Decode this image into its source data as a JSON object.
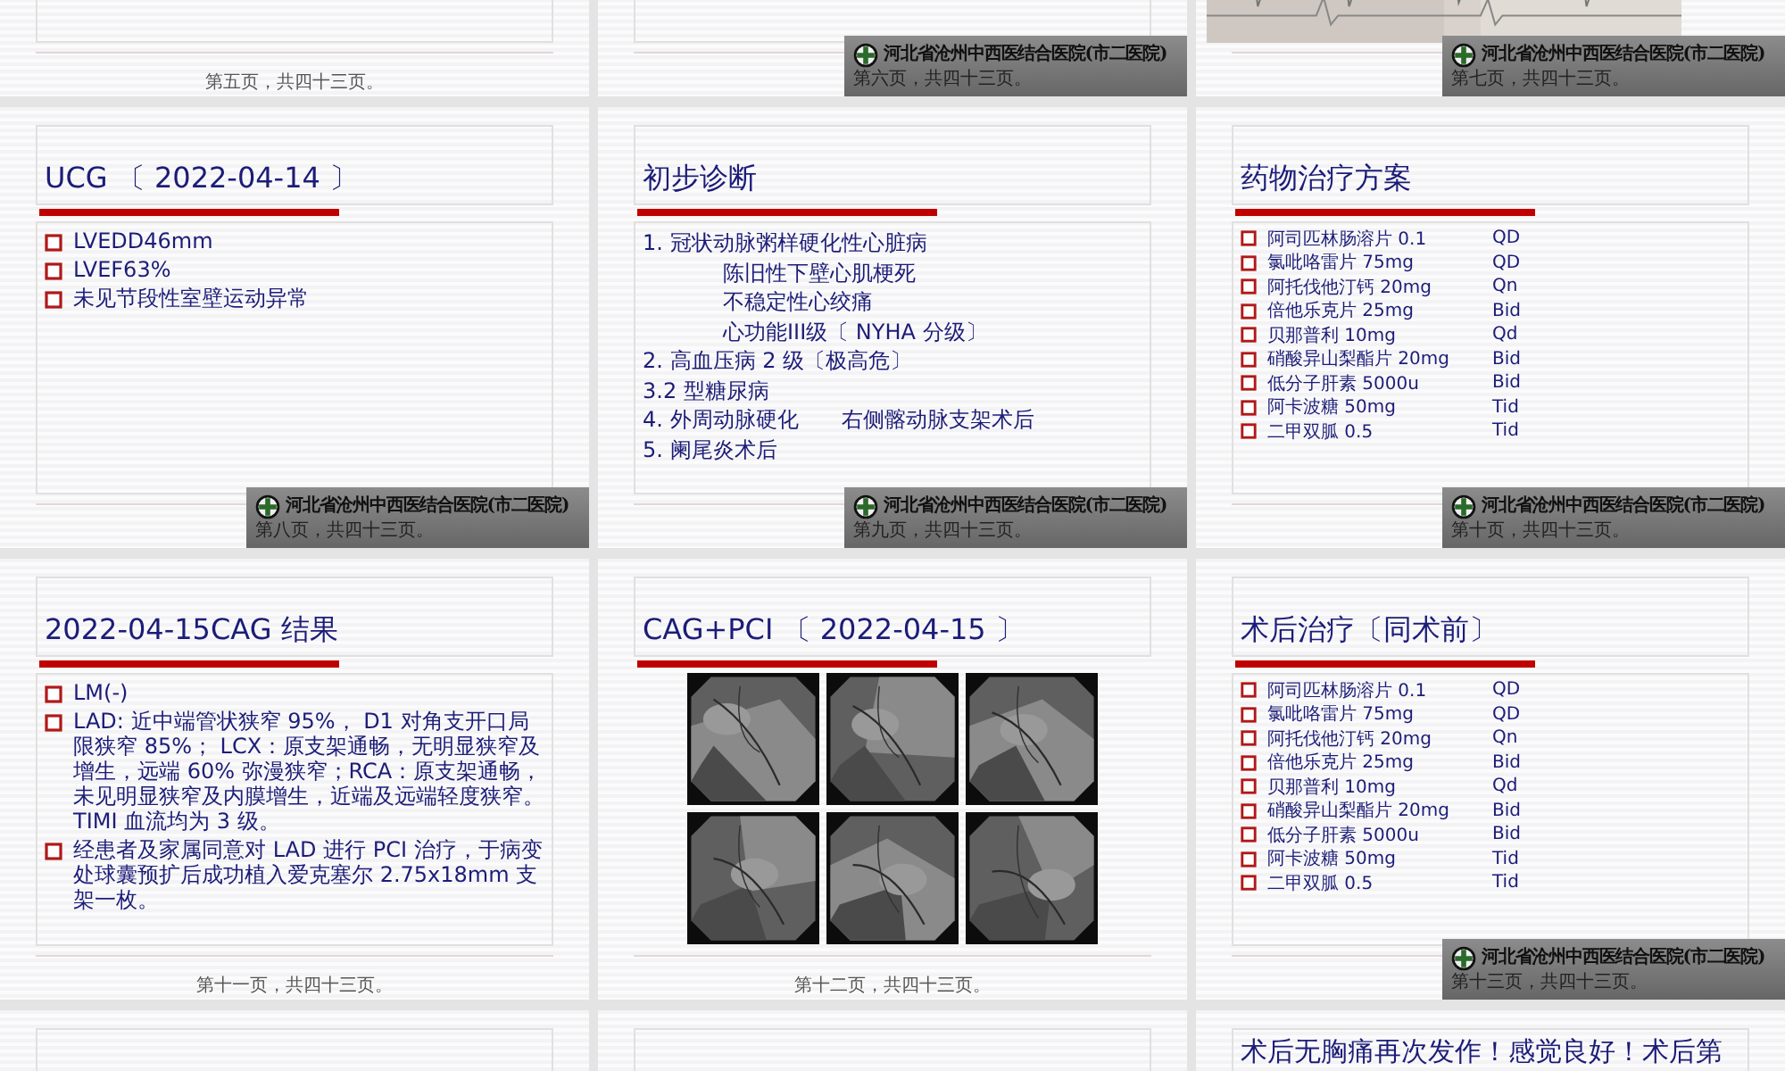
{
  "slides": [
    {
      "footer": "第五页，共四十三页。",
      "kind": "blank"
    },
    {
      "footer": "第六页，共四十三页。",
      "logo": {
        "name": "河北省沧州中西医结合医院(市二医院)"
      },
      "kind": "blank"
    },
    {
      "footer": "第七页，共四十三页。",
      "logo": {
        "name": "河北省沧州中西医结合医院(市二医院)"
      },
      "kind": "picture"
    },
    {
      "title": "UCG 〔 2022-04-14 〕",
      "footer": "第八页，共四十三页。",
      "logo": {
        "name": "河北省沧州中西医结合医院(市二医院)"
      },
      "kind": "bullets",
      "items": [
        "LVEDD46mm",
        "LVEF63%",
        "未见节段性室壁运动异常"
      ]
    },
    {
      "title": "初步诊断",
      "footer": "第九页，共四十三页。",
      "logo": {
        "name": "河北省沧州中西医结合医院(市二医院)"
      },
      "kind": "numbered",
      "items": [
        {
          "text": "1. 冠状动脉粥样硬化性心脏病",
          "children": [
            {
              "text": "陈旧性下壁心肌梗死"
            },
            {
              "text": "不稳定性心绞痛"
            },
            {
              "text": "心功能III级〔 NYHA 分级〕"
            }
          ]
        },
        {
          "text": "2. 高血压病 2 级〔极高危〕"
        },
        {
          "text": "3.2 型糖尿病"
        },
        {
          "text": "4. 外周动脉硬化　　右侧髂动脉支架术后"
        },
        {
          "text": "5. 阑尾炎术后"
        }
      ]
    },
    {
      "title": "药物治疗方案",
      "footer": "第十页，共四十三页。",
      "logo": {
        "name": "河北省沧州中西医结合医院(市二医院)"
      },
      "kind": "meds",
      "items": [
        {
          "drug": "阿司匹林肠溶片 0.1",
          "frequency": "QD"
        },
        {
          "drug": "氯吡咯雷片 75mg",
          "frequency": "QD"
        },
        {
          "drug": "阿托伐他汀钙 20mg",
          "frequency": "Qn"
        },
        {
          "drug": "倍他乐克片 25mg",
          "frequency": "Bid"
        },
        {
          "drug": "贝那普利 10mg",
          "frequency": "Qd"
        },
        {
          "drug": "硝酸异山梨酯片 20mg",
          "frequency": "Bid"
        },
        {
          "drug": "低分子肝素 5000u",
          "frequency": "Bid"
        },
        {
          "drug": "阿卡波糖 50mg",
          "frequency": "Tid"
        },
        {
          "drug": "二甲双胍 0.5",
          "frequency": "Tid"
        }
      ]
    },
    {
      "title": "2022-04-15CAG 结果",
      "footer": "第十一页，共四十三页。",
      "kind": "bullets",
      "items": [
        "LM(-)",
        "LAD: 近中端管状狭窄 95%， D1 对角支开口局限狭窄 85%； LCX：原支架通畅，无明显狭窄及增生，远端 60% 弥漫狭窄；RCA：原支架通畅，未见明显狭窄及内膜增生，近端及远端轻度狭窄。 TIMI 血流均为 3 级。",
        "经患者及家属同意对 LAD 进行 PCI 治疗，于病变处球囊预扩后成功植入爱克塞尔 2.75x18mm 支架一枚。"
      ]
    },
    {
      "title": "CAG+PCI 〔 2022-04-15 〕",
      "footer": "第十二页，共四十三页。",
      "kind": "images"
    },
    {
      "title": "术后治疗〔同术前〕",
      "footer": "第十三页，共四十三页。",
      "logo": {
        "name": "河北省沧州中西医结合医院(市二医院)"
      },
      "kind": "meds",
      "items": [
        {
          "drug": "阿司匹林肠溶片 0.1",
          "frequency": "QD"
        },
        {
          "drug": "氯吡咯雷片 75mg",
          "frequency": "QD"
        },
        {
          "drug": "阿托伐他汀钙 20mg",
          "frequency": "Qn"
        },
        {
          "drug": "倍他乐克片 25mg",
          "frequency": "Bid"
        },
        {
          "drug": "贝那普利 10mg",
          "frequency": "Qd"
        },
        {
          "drug": "硝酸异山梨酯片 20mg",
          "frequency": "Bid"
        },
        {
          "drug": "低分子肝素 5000u",
          "frequency": "Bid"
        },
        {
          "drug": "阿卡波糖 50mg",
          "frequency": "Tid"
        },
        {
          "drug": "二甲双胍 0.5",
          "frequency": "Tid"
        }
      ]
    },
    {
      "kind": "title_only"
    },
    {
      "kind": "title_only"
    },
    {
      "title": "术后无胸痛再次发作！感觉良好！术后第",
      "kind": "text"
    }
  ]
}
